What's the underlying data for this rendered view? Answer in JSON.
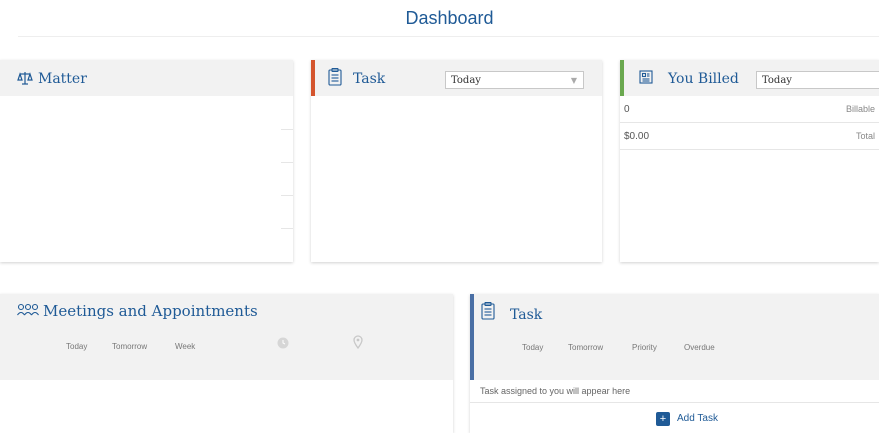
{
  "page": {
    "title": "Dashboard"
  },
  "matter_card": {
    "title": "Matter",
    "icon": "scale-icon"
  },
  "task_card": {
    "title": "Task",
    "icon": "clipboard-icon",
    "filter_value": "Today",
    "accent_color": "#d4552e"
  },
  "billed_card": {
    "title": "You Billed",
    "icon": "invoice-icon",
    "filter_value": "Today",
    "accent_color": "#6aa84f",
    "rows": [
      {
        "value": "0",
        "label": "Billable"
      },
      {
        "value": "$0.00",
        "label": "Total"
      }
    ]
  },
  "meetings_card": {
    "title": "Meetings and Appointments",
    "icon": "people-icon",
    "tabs": [
      "Today",
      "Tomorrow",
      "Week"
    ]
  },
  "task_list_card": {
    "title": "Task",
    "icon": "clipboard-icon",
    "accent_color": "#4a6fa5",
    "tabs": [
      "Today",
      "Tomorrow",
      "Priority",
      "Overdue"
    ],
    "empty_message": "Task assigned to you will appear here",
    "add_label": "Add Task"
  },
  "colors": {
    "brand": "#1f5a96",
    "header_bg": "#f2f2f2"
  }
}
